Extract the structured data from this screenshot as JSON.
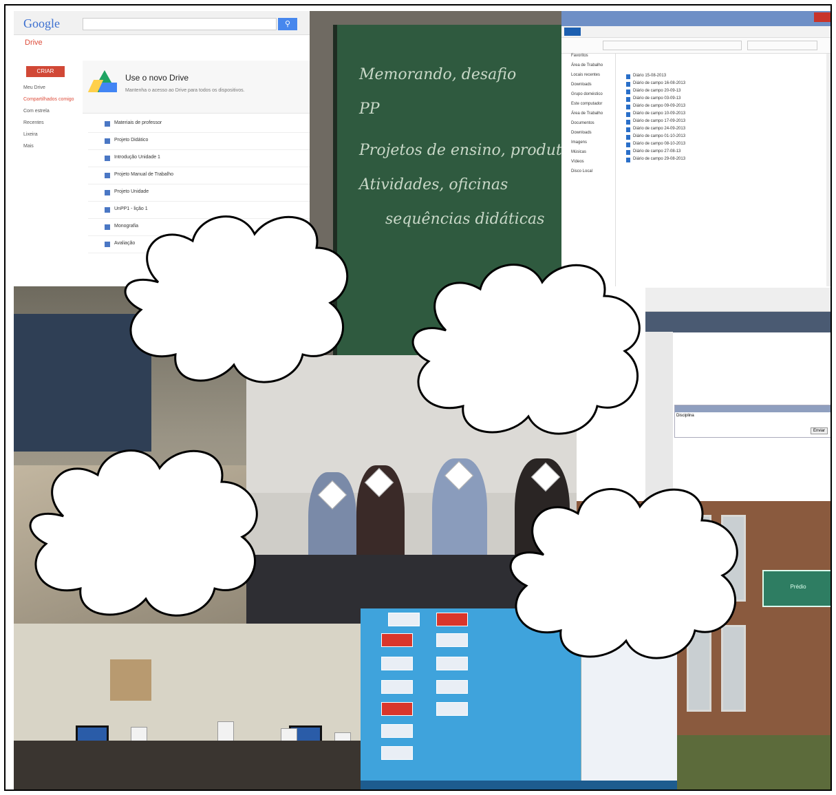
{
  "drive": {
    "logo": "Google",
    "section": "Drive",
    "create_label": "CRIAR",
    "nav": [
      "Meu Drive",
      "Compartilhados comigo",
      "Com estrela",
      "Recentes",
      "Lixeira",
      "Mais"
    ],
    "promo_title": "Use o novo Drive",
    "promo_text": "Mantenha o acesso ao Drive para todos os dispositivos.",
    "files": [
      "Materiais de professor",
      "Projeto Didático",
      "Introdução Unidade 1",
      "Projeto Manual de Trabalho",
      "Projeto Unidade",
      "UnPP1 - lição 1",
      "Monografia",
      "Avaliação"
    ]
  },
  "chalkboard": {
    "lines": [
      "Memorando, desafio",
      "PP",
      "Projetos de ensino, produto",
      "Atividades, oficinas",
      "sequências didáticas"
    ]
  },
  "explorer": {
    "nav": [
      "Favoritos",
      "Área de Trabalho",
      "Locais recentes",
      "Downloads",
      "Grupo doméstico",
      "Este computador",
      "Área de Trabalho",
      "Documentos",
      "Downloads",
      "Imagens",
      "Músicas",
      "Vídeos",
      "Disco Local"
    ],
    "files": [
      "Diário 15-08-2013",
      "Diário de campo 16-08-2013",
      "Diário de campo 20-09-13",
      "Diário de campo 03-09-13",
      "Diário de campo 09-09-2013",
      "Diário de campo 10-09-2013",
      "Diário de campo 17-09-2013",
      "Diário de campo 24-09-2013",
      "Diário de campo 01-10-2013",
      "Diário de campo 08-10-2013",
      "Diário de campo 27-08-13",
      "Diário de campo 29-08-2013"
    ]
  },
  "browser": {
    "table_title": "Disciplina",
    "button_label": "Enviar"
  },
  "building_sign": "Prédio",
  "cloud_color": "#ffffff"
}
